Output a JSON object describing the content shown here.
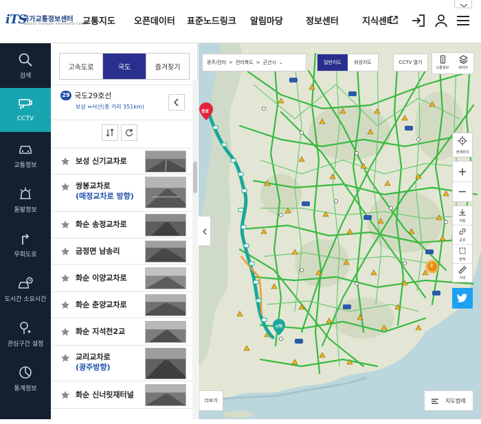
{
  "header": {
    "logo_mark": "iTS",
    "logo_name": "국가교통정보센터",
    "logo_sub": "National Transport Information Center",
    "nav": [
      "교통지도",
      "오픈데이터",
      "표준노드링크",
      "알림마당",
      "정보센터",
      "지식센터"
    ]
  },
  "sidebar": {
    "items": [
      {
        "label": "검색",
        "icon": "search-icon"
      },
      {
        "label": "CCTV",
        "icon": "cctv-icon"
      },
      {
        "label": "교통정보",
        "icon": "car-icon"
      },
      {
        "label": "돌발정보",
        "icon": "alert-lamp-icon"
      },
      {
        "label": "우회도로",
        "icon": "detour-icon"
      },
      {
        "label": "도시간 소요시간",
        "icon": "travel-time-icon"
      },
      {
        "label": "관심구간 설정",
        "icon": "favorite-route-icon"
      },
      {
        "label": "통계정보",
        "icon": "statistics-icon"
      }
    ]
  },
  "panel": {
    "tabs": [
      "고속도로",
      "국도",
      "즐겨찾기"
    ],
    "active_tab": "국도",
    "route": {
      "number": "29",
      "name": "국도29호선",
      "from": "보성",
      "to": "서산",
      "distance": "(총 거리 351km)"
    },
    "cctv_list": [
      {
        "name": "보성 신기교차로",
        "direction": ""
      },
      {
        "name": "쌍봉교차로",
        "direction": "(매정교차로 방향)"
      },
      {
        "name": "화순 송정교차로",
        "direction": ""
      },
      {
        "name": "금정면 남송리",
        "direction": ""
      },
      {
        "name": "화순 이양교차로",
        "direction": ""
      },
      {
        "name": "화순 춘양교차로",
        "direction": ""
      },
      {
        "name": "화순 지석천2교",
        "direction": ""
      },
      {
        "name": "교리교차로",
        "direction": "(광주방향)"
      },
      {
        "name": "화순 신너릿재터널",
        "direction": ""
      }
    ]
  },
  "map": {
    "breadcrumb": [
      "광주/전라",
      ">",
      "전라북도",
      ">",
      "군산시"
    ],
    "map_types": [
      "일반지도",
      "위성지도"
    ],
    "active_map_type": "일반지도",
    "cctv_toggle": "CCTV 열기",
    "top_icons": [
      "소통정보",
      "레이어"
    ],
    "controls": {
      "locate": "현재위치",
      "zoom_in": "+",
      "zoom_out": "−",
      "save": "저장",
      "share": "공유",
      "area": "면적",
      "distance": "거리"
    },
    "start_label": "시작",
    "end_label": "종료",
    "cluster_count": "2",
    "more_label": "더보기",
    "legend_label": "지도범례"
  },
  "colors": {
    "accent": "#2a2f8f",
    "teal": "#17a5b0",
    "nav_bg": "#12202f",
    "route_line": "#1aa89a",
    "road_ok": "#2fb83a",
    "brand_blue": "#1f4fa8"
  }
}
